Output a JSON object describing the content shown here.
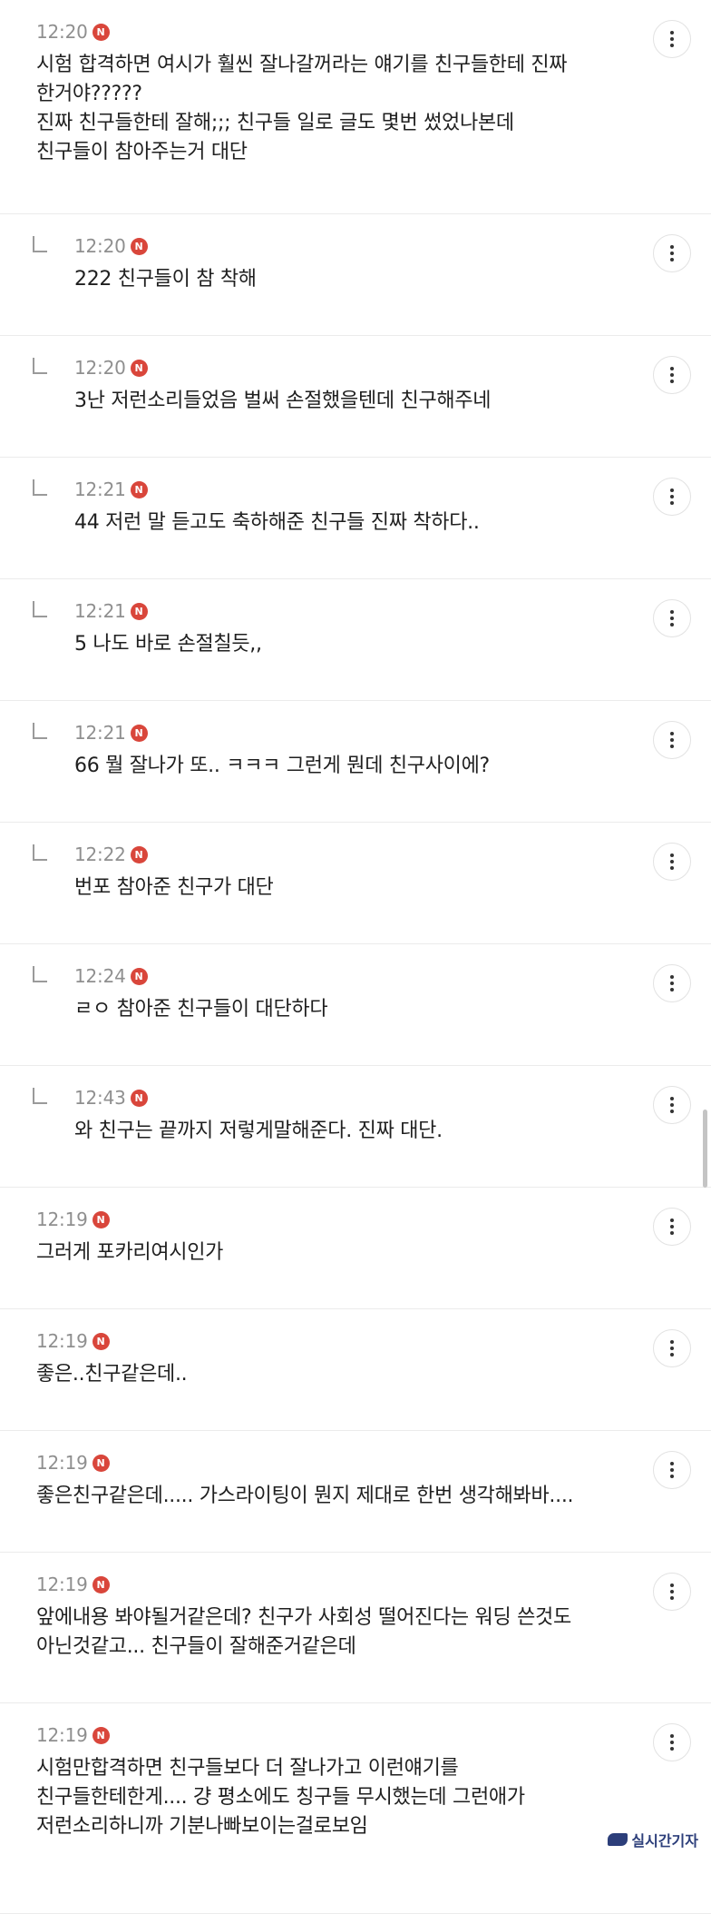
{
  "comments": [
    {
      "type": "top",
      "time": "12:20",
      "badge": "N",
      "text": "시험 합격하면 여시가 훨씬 잘나갈꺼라는 얘기를 친구들한테 진짜\n한거야?????\n진짜 친구들한테 잘해;;; 친구들 일로 글도 몇번 썼었나본데\n친구들이 참아주는거 대단"
    },
    {
      "type": "reply",
      "time": "12:20",
      "badge": "N",
      "text": "222 친구들이 참 착해"
    },
    {
      "type": "reply",
      "time": "12:20",
      "badge": "N",
      "text": "3난 저런소리들었음 벌써 손절했을텐데 친구해주네"
    },
    {
      "type": "reply",
      "time": "12:21",
      "badge": "N",
      "text": "44 저런 말 듣고도 축하해준 친구들 진짜 착하다.."
    },
    {
      "type": "reply",
      "time": "12:21",
      "badge": "N",
      "text": "5 나도 바로 손절칠듯,,"
    },
    {
      "type": "reply",
      "time": "12:21",
      "badge": "N",
      "text": "66 뭘 잘나가 또.. ㅋㅋㅋ 그런게 뭔데 친구사이에?"
    },
    {
      "type": "reply",
      "time": "12:22",
      "badge": "N",
      "text": "번포 참아준 친구가 대단"
    },
    {
      "type": "reply",
      "time": "12:24",
      "badge": "N",
      "text": "ㄹㅇ 참아준 친구들이 대단하다"
    },
    {
      "type": "reply",
      "time": "12:43",
      "badge": "N",
      "text": "와 친구는 끝까지 저렇게말해준다. 진짜 대단."
    },
    {
      "type": "top",
      "time": "12:19",
      "badge": "N",
      "text": "그러게 포카리여시인가"
    },
    {
      "type": "top",
      "time": "12:19",
      "badge": "N",
      "text": "좋은..친구같은데.."
    },
    {
      "type": "top",
      "time": "12:19",
      "badge": "N",
      "text": "좋은친구같은데..... 가스라이팅이 뭔지 제대로 한번 생각해봐바...."
    },
    {
      "type": "top",
      "time": "12:19",
      "badge": "N",
      "text": "앞에내용 봐야될거같은데? 친구가 사회성 떨어진다는 워딩 쓴것도\n아닌것같고... 친구들이 잘해준거같은데"
    },
    {
      "type": "top",
      "time": "12:19",
      "badge": "N",
      "text": "시험만합격하면 친구들보다 더 잘나가고 이런얘기를\n친구들한테한게.... 걍 평소에도 칭구들 무시했는데 그런애가\n저런소리하니까 기분나빠보이는걸로보임"
    }
  ],
  "watermark": "실시간기자"
}
